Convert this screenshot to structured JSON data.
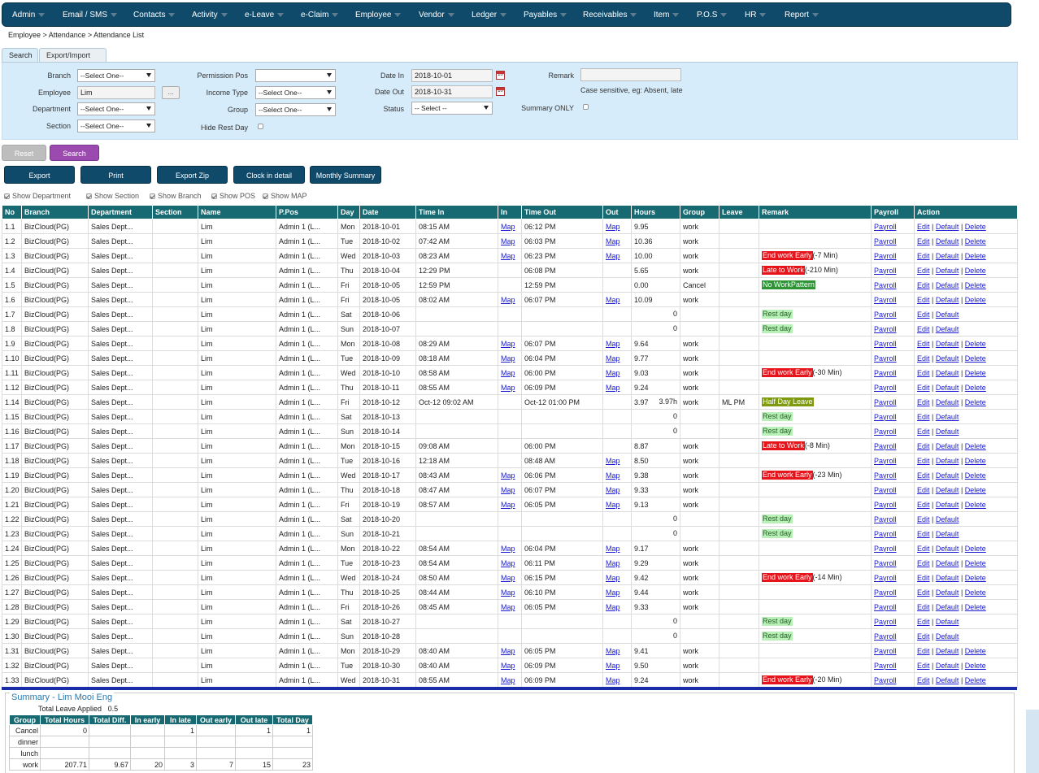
{
  "nav": [
    "Admin",
    "Email / SMS",
    "Contacts",
    "Activity",
    "e-Leave",
    "e-Claim",
    "Employee",
    "Vendor",
    "Ledger",
    "Payables",
    "Receivables",
    "Item",
    "P.O.S",
    "HR",
    "Report"
  ],
  "breadcrumb": "Employee > Attendance > Attendance List",
  "tabs": {
    "search": "Search",
    "export": "Export/Import"
  },
  "filter": {
    "branch_label": "Branch",
    "branch_value": "--Select One--",
    "employee_label": "Employee",
    "employee_value": "Lim",
    "employee_btn": "...",
    "department_label": "Department",
    "department_value": "--Select One--",
    "section_label": "Section",
    "section_value": "--Select One--",
    "perm_pos_label": "Permission Pos",
    "perm_pos_value": "",
    "income_type_label": "Income Type",
    "income_type_value": "--Select One--",
    "group_label": "Group",
    "group_value": "--Select One--",
    "hide_rest_label": "Hide Rest Day",
    "date_in_label": "Date In",
    "date_in_value": "2018-10-01",
    "date_out_label": "Date Out",
    "date_out_value": "2018-10-31",
    "status_label": "Status",
    "status_value": "-- Select --",
    "remark_label": "Remark",
    "remark_value": "",
    "remark_hint": "Case sensitive, eg: Absent, late",
    "summary_only_label": "Summary ONLY",
    "cal_icon_text": "10"
  },
  "buttons": {
    "reset": "Reset",
    "search": "Search",
    "export": "Export",
    "print": "Print",
    "export_zip": "Export Zip",
    "clock_detail": "Clock in detail",
    "monthly_summary": "Monthly Summary"
  },
  "show_options": [
    "Show Department",
    "Show Section",
    "Show Branch",
    "Show POS",
    "Show MAP"
  ],
  "table": {
    "headers": [
      "No",
      "Branch",
      "Department",
      "Section",
      "Name",
      "P.Pos",
      "Day",
      "Date",
      "Time In",
      "In",
      "Time Out",
      "Out",
      "Hours",
      "Group",
      "Leave",
      "Remark",
      "Payroll",
      "Action"
    ],
    "link_map": "Map",
    "link_payroll": "Payroll",
    "link_edit": "Edit",
    "link_default": "Default",
    "link_delete": "Delete",
    "sep": "|",
    "rows": [
      {
        "no": "1.1",
        "branch": "BizCloud(PG)",
        "dept": "Sales Dept...",
        "section": "",
        "name": "Lim",
        "ppos": "Admin 1 (L...",
        "day": "Mon",
        "date": "2018-10-01",
        "tin": "08:15 AM",
        "in_map": true,
        "tout": "06:12 PM",
        "out_map": true,
        "hours": "9.95",
        "group": "work",
        "leave": "",
        "remark": "",
        "remark_suffix": "",
        "tag": "",
        "delete": true
      },
      {
        "no": "1.2",
        "branch": "BizCloud(PG)",
        "dept": "Sales Dept...",
        "section": "",
        "name": "Lim",
        "ppos": "Admin 1 (L...",
        "day": "Tue",
        "date": "2018-10-02",
        "tin": "07:42 AM",
        "in_map": true,
        "tout": "06:03 PM",
        "out_map": true,
        "hours": "10.36",
        "group": "work",
        "leave": "",
        "remark": "",
        "remark_suffix": "",
        "tag": "",
        "delete": true
      },
      {
        "no": "1.3",
        "branch": "BizCloud(PG)",
        "dept": "Sales Dept...",
        "section": "",
        "name": "Lim",
        "ppos": "Admin 1 (L...",
        "day": "Wed",
        "date": "2018-10-03",
        "tin": "08:23 AM",
        "in_map": true,
        "tout": "06:23 PM",
        "out_map": true,
        "hours": "10.00",
        "group": "work",
        "leave": "",
        "remark": "End work Early",
        "remark_suffix": "(-7 Min)",
        "tag": "red",
        "delete": true
      },
      {
        "no": "1.4",
        "branch": "BizCloud(PG)",
        "dept": "Sales Dept...",
        "section": "",
        "name": "Lim",
        "ppos": "Admin 1 (L...",
        "day": "Thu",
        "date": "2018-10-04",
        "tin": "12:29 PM",
        "in_map": false,
        "tout": "06:08 PM",
        "out_map": false,
        "hours": "5.65",
        "group": "work",
        "leave": "",
        "remark": "Late to Work",
        "remark_suffix": "(-210 Min)",
        "tag": "red",
        "delete": true
      },
      {
        "no": "1.5",
        "branch": "BizCloud(PG)",
        "dept": "Sales Dept...",
        "section": "",
        "name": "Lim",
        "ppos": "Admin 1 (L...",
        "day": "Fri",
        "date": "2018-10-05",
        "tin": "12:59 PM",
        "in_map": false,
        "tout": "12:59 PM",
        "out_map": false,
        "hours": "0.00",
        "group": "Cancel",
        "leave": "",
        "remark": "No WorkPattern",
        "remark_suffix": "",
        "tag": "green",
        "delete": true
      },
      {
        "no": "1.6",
        "branch": "BizCloud(PG)",
        "dept": "Sales Dept...",
        "section": "",
        "name": "Lim",
        "ppos": "Admin 1 (L...",
        "day": "Fri",
        "date": "2018-10-05",
        "tin": "08:02 AM",
        "in_map": true,
        "tout": "06:07 PM",
        "out_map": true,
        "hours": "10.09",
        "group": "work",
        "leave": "",
        "remark": "",
        "remark_suffix": "",
        "tag": "",
        "delete": true
      },
      {
        "no": "1.7",
        "branch": "BizCloud(PG)",
        "dept": "Sales Dept...",
        "section": "",
        "name": "Lim",
        "ppos": "Admin 1 (L...",
        "day": "Sat",
        "date": "2018-10-06",
        "tin": "",
        "in_map": false,
        "tout": "",
        "out_map": false,
        "hours": "",
        "hours_right": "0",
        "group": "",
        "leave": "",
        "remark": "Rest day",
        "remark_suffix": "",
        "tag": "lgreen",
        "delete": false
      },
      {
        "no": "1.8",
        "branch": "BizCloud(PG)",
        "dept": "Sales Dept...",
        "section": "",
        "name": "Lim",
        "ppos": "Admin 1 (L...",
        "day": "Sun",
        "date": "2018-10-07",
        "tin": "",
        "in_map": false,
        "tout": "",
        "out_map": false,
        "hours": "",
        "hours_right": "0",
        "group": "",
        "leave": "",
        "remark": "Rest day",
        "remark_suffix": "",
        "tag": "lgreen",
        "delete": false
      },
      {
        "no": "1.9",
        "branch": "BizCloud(PG)",
        "dept": "Sales Dept...",
        "section": "",
        "name": "Lim",
        "ppos": "Admin 1 (L...",
        "day": "Mon",
        "date": "2018-10-08",
        "tin": "08:29 AM",
        "in_map": true,
        "tout": "06:07 PM",
        "out_map": true,
        "hours": "9.64",
        "group": "work",
        "leave": "",
        "remark": "",
        "remark_suffix": "",
        "tag": "",
        "delete": true
      },
      {
        "no": "1.10",
        "branch": "BizCloud(PG)",
        "dept": "Sales Dept...",
        "section": "",
        "name": "Lim",
        "ppos": "Admin 1 (L...",
        "day": "Tue",
        "date": "2018-10-09",
        "tin": "08:18 AM",
        "in_map": true,
        "tout": "06:04 PM",
        "out_map": true,
        "hours": "9.77",
        "group": "work",
        "leave": "",
        "remark": "",
        "remark_suffix": "",
        "tag": "",
        "delete": true
      },
      {
        "no": "1.11",
        "branch": "BizCloud(PG)",
        "dept": "Sales Dept...",
        "section": "",
        "name": "Lim",
        "ppos": "Admin 1 (L...",
        "day": "Wed",
        "date": "2018-10-10",
        "tin": "08:58 AM",
        "in_map": true,
        "tout": "06:00 PM",
        "out_map": true,
        "hours": "9.03",
        "group": "work",
        "leave": "",
        "remark": "End work Early",
        "remark_suffix": "(-30 Min)",
        "tag": "red",
        "delete": true
      },
      {
        "no": "1.12",
        "branch": "BizCloud(PG)",
        "dept": "Sales Dept...",
        "section": "",
        "name": "Lim",
        "ppos": "Admin 1 (L...",
        "day": "Thu",
        "date": "2018-10-11",
        "tin": "08:55 AM",
        "in_map": true,
        "tout": "06:09 PM",
        "out_map": true,
        "hours": "9.24",
        "group": "work",
        "leave": "",
        "remark": "",
        "remark_suffix": "",
        "tag": "",
        "delete": true
      },
      {
        "no": "1.14",
        "branch": "BizCloud(PG)",
        "dept": "Sales Dept...",
        "section": "",
        "name": "Lim",
        "ppos": "Admin 1 (L...",
        "day": "Fri",
        "date": "2018-10-12",
        "tin": "Oct-12 09:02 AM",
        "in_map": false,
        "tout": "Oct-12 01:00 PM",
        "out_map": false,
        "hours": "3.97",
        "hours_right": "3.97h",
        "group": "work",
        "leave": "ML PM",
        "remark": "Half Day Leave",
        "remark_suffix": "",
        "tag": "olive",
        "delete": true
      },
      {
        "no": "1.15",
        "branch": "BizCloud(PG)",
        "dept": "Sales Dept...",
        "section": "",
        "name": "Lim",
        "ppos": "Admin 1 (L...",
        "day": "Sat",
        "date": "2018-10-13",
        "tin": "",
        "in_map": false,
        "tout": "",
        "out_map": false,
        "hours": "",
        "hours_right": "0",
        "group": "",
        "leave": "",
        "remark": "Rest day",
        "remark_suffix": "",
        "tag": "lgreen",
        "delete": false
      },
      {
        "no": "1.16",
        "branch": "BizCloud(PG)",
        "dept": "Sales Dept...",
        "section": "",
        "name": "Lim",
        "ppos": "Admin 1 (L...",
        "day": "Sun",
        "date": "2018-10-14",
        "tin": "",
        "in_map": false,
        "tout": "",
        "out_map": false,
        "hours": "",
        "hours_right": "0",
        "group": "",
        "leave": "",
        "remark": "Rest day",
        "remark_suffix": "",
        "tag": "lgreen",
        "delete": false
      },
      {
        "no": "1.17",
        "branch": "BizCloud(PG)",
        "dept": "Sales Dept...",
        "section": "",
        "name": "Lim",
        "ppos": "Admin 1 (L...",
        "day": "Mon",
        "date": "2018-10-15",
        "tin": "09:08 AM",
        "in_map": false,
        "tout": "06:00 PM",
        "out_map": false,
        "hours": "8.87",
        "group": "work",
        "leave": "",
        "remark": "Late to Work",
        "remark_suffix": "(-8 Min)",
        "tag": "red",
        "delete": true
      },
      {
        "no": "1.18",
        "branch": "BizCloud(PG)",
        "dept": "Sales Dept...",
        "section": "",
        "name": "Lim",
        "ppos": "Admin 1 (L...",
        "day": "Tue",
        "date": "2018-10-16",
        "tin": "12:18 AM",
        "in_map": false,
        "tout": "08:48 AM",
        "out_map": true,
        "hours": "8.50",
        "group": "work",
        "leave": "",
        "remark": "",
        "remark_suffix": "",
        "tag": "",
        "delete": true
      },
      {
        "no": "1.19",
        "branch": "BizCloud(PG)",
        "dept": "Sales Dept...",
        "section": "",
        "name": "Lim",
        "ppos": "Admin 1 (L...",
        "day": "Wed",
        "date": "2018-10-17",
        "tin": "08:43 AM",
        "in_map": true,
        "tout": "06:06 PM",
        "out_map": true,
        "hours": "9.38",
        "group": "work",
        "leave": "",
        "remark": "End work Early",
        "remark_suffix": "(-23 Min)",
        "tag": "red",
        "delete": true
      },
      {
        "no": "1.20",
        "branch": "BizCloud(PG)",
        "dept": "Sales Dept...",
        "section": "",
        "name": "Lim",
        "ppos": "Admin 1 (L...",
        "day": "Thu",
        "date": "2018-10-18",
        "tin": "08:47 AM",
        "in_map": true,
        "tout": "06:07 PM",
        "out_map": true,
        "hours": "9.33",
        "group": "work",
        "leave": "",
        "remark": "",
        "remark_suffix": "",
        "tag": "",
        "delete": true
      },
      {
        "no": "1.21",
        "branch": "BizCloud(PG)",
        "dept": "Sales Dept...",
        "section": "",
        "name": "Lim",
        "ppos": "Admin 1 (L...",
        "day": "Fri",
        "date": "2018-10-19",
        "tin": "08:57 AM",
        "in_map": true,
        "tout": "06:05 PM",
        "out_map": true,
        "hours": "9.13",
        "group": "work",
        "leave": "",
        "remark": "",
        "remark_suffix": "",
        "tag": "",
        "delete": true
      },
      {
        "no": "1.22",
        "branch": "BizCloud(PG)",
        "dept": "Sales Dept...",
        "section": "",
        "name": "Lim",
        "ppos": "Admin 1 (L...",
        "day": "Sat",
        "date": "2018-10-20",
        "tin": "",
        "in_map": false,
        "tout": "",
        "out_map": false,
        "hours": "",
        "hours_right": "0",
        "group": "",
        "leave": "",
        "remark": "Rest day",
        "remark_suffix": "",
        "tag": "lgreen",
        "delete": false
      },
      {
        "no": "1.23",
        "branch": "BizCloud(PG)",
        "dept": "Sales Dept...",
        "section": "",
        "name": "Lim",
        "ppos": "Admin 1 (L...",
        "day": "Sun",
        "date": "2018-10-21",
        "tin": "",
        "in_map": false,
        "tout": "",
        "out_map": false,
        "hours": "",
        "hours_right": "0",
        "group": "",
        "leave": "",
        "remark": "Rest day",
        "remark_suffix": "",
        "tag": "lgreen",
        "delete": false
      },
      {
        "no": "1.24",
        "branch": "BizCloud(PG)",
        "dept": "Sales Dept...",
        "section": "",
        "name": "Lim",
        "ppos": "Admin 1 (L...",
        "day": "Mon",
        "date": "2018-10-22",
        "tin": "08:54 AM",
        "in_map": true,
        "tout": "06:04 PM",
        "out_map": true,
        "hours": "9.17",
        "group": "work",
        "leave": "",
        "remark": "",
        "remark_suffix": "",
        "tag": "",
        "delete": true
      },
      {
        "no": "1.25",
        "branch": "BizCloud(PG)",
        "dept": "Sales Dept...",
        "section": "",
        "name": "Lim",
        "ppos": "Admin 1 (L...",
        "day": "Tue",
        "date": "2018-10-23",
        "tin": "08:54 AM",
        "in_map": true,
        "tout": "06:11 PM",
        "out_map": true,
        "hours": "9.29",
        "group": "work",
        "leave": "",
        "remark": "",
        "remark_suffix": "",
        "tag": "",
        "delete": true
      },
      {
        "no": "1.26",
        "branch": "BizCloud(PG)",
        "dept": "Sales Dept...",
        "section": "",
        "name": "Lim",
        "ppos": "Admin 1 (L...",
        "day": "Wed",
        "date": "2018-10-24",
        "tin": "08:50 AM",
        "in_map": true,
        "tout": "06:15 PM",
        "out_map": true,
        "hours": "9.42",
        "group": "work",
        "leave": "",
        "remark": "End work Early",
        "remark_suffix": "(-14 Min)",
        "tag": "red",
        "delete": true
      },
      {
        "no": "1.27",
        "branch": "BizCloud(PG)",
        "dept": "Sales Dept...",
        "section": "",
        "name": "Lim",
        "ppos": "Admin 1 (L...",
        "day": "Thu",
        "date": "2018-10-25",
        "tin": "08:44 AM",
        "in_map": true,
        "tout": "06:10 PM",
        "out_map": true,
        "hours": "9.44",
        "group": "work",
        "leave": "",
        "remark": "",
        "remark_suffix": "",
        "tag": "",
        "delete": true
      },
      {
        "no": "1.28",
        "branch": "BizCloud(PG)",
        "dept": "Sales Dept...",
        "section": "",
        "name": "Lim",
        "ppos": "Admin 1 (L...",
        "day": "Fri",
        "date": "2018-10-26",
        "tin": "08:45 AM",
        "in_map": true,
        "tout": "06:05 PM",
        "out_map": true,
        "hours": "9.33",
        "group": "work",
        "leave": "",
        "remark": "",
        "remark_suffix": "",
        "tag": "",
        "delete": true
      },
      {
        "no": "1.29",
        "branch": "BizCloud(PG)",
        "dept": "Sales Dept...",
        "section": "",
        "name": "Lim",
        "ppos": "Admin 1 (L...",
        "day": "Sat",
        "date": "2018-10-27",
        "tin": "",
        "in_map": false,
        "tout": "",
        "out_map": false,
        "hours": "",
        "hours_right": "0",
        "group": "",
        "leave": "",
        "remark": "Rest day",
        "remark_suffix": "",
        "tag": "lgreen",
        "delete": false
      },
      {
        "no": "1.30",
        "branch": "BizCloud(PG)",
        "dept": "Sales Dept...",
        "section": "",
        "name": "Lim",
        "ppos": "Admin 1 (L...",
        "day": "Sun",
        "date": "2018-10-28",
        "tin": "",
        "in_map": false,
        "tout": "",
        "out_map": false,
        "hours": "",
        "hours_right": "0",
        "group": "",
        "leave": "",
        "remark": "Rest day",
        "remark_suffix": "",
        "tag": "lgreen",
        "delete": false
      },
      {
        "no": "1.31",
        "branch": "BizCloud(PG)",
        "dept": "Sales Dept...",
        "section": "",
        "name": "Lim",
        "ppos": "Admin 1 (L...",
        "day": "Mon",
        "date": "2018-10-29",
        "tin": "08:40 AM",
        "in_map": true,
        "tout": "06:05 PM",
        "out_map": true,
        "hours": "9.41",
        "group": "work",
        "leave": "",
        "remark": "",
        "remark_suffix": "",
        "tag": "",
        "delete": true
      },
      {
        "no": "1.32",
        "branch": "BizCloud(PG)",
        "dept": "Sales Dept...",
        "section": "",
        "name": "Lim",
        "ppos": "Admin 1 (L...",
        "day": "Tue",
        "date": "2018-10-30",
        "tin": "08:40 AM",
        "in_map": true,
        "tout": "06:09 PM",
        "out_map": true,
        "hours": "9.50",
        "group": "work",
        "leave": "",
        "remark": "",
        "remark_suffix": "",
        "tag": "",
        "delete": true
      },
      {
        "no": "1.33",
        "branch": "BizCloud(PG)",
        "dept": "Sales Dept...",
        "section": "",
        "name": "Lim",
        "ppos": "Admin 1 (L...",
        "day": "Wed",
        "date": "2018-10-31",
        "tin": "08:55 AM",
        "in_map": true,
        "tout": "06:09 PM",
        "out_map": true,
        "hours": "9.24",
        "group": "work",
        "leave": "",
        "remark": "End work Early",
        "remark_suffix": "(-20 Min)",
        "tag": "red",
        "delete": true
      }
    ]
  },
  "summary": {
    "title": "Summary - Lim Mooi Eng",
    "leave_applied_label": "Total Leave Applied",
    "leave_applied_value": "0.5",
    "headers": [
      "Group",
      "Total Hours",
      "Total Diff.",
      "In early",
      "In late",
      "Out early",
      "Out late",
      "Total Day"
    ],
    "rows": [
      [
        "Cancel",
        "0",
        "",
        "",
        "1",
        "",
        "1",
        "1"
      ],
      [
        "dinner",
        "",
        "",
        "",
        "",
        "",
        "",
        ""
      ],
      [
        "lunch",
        "",
        "",
        "",
        "",
        "",
        "",
        ""
      ],
      [
        "work",
        "207.71",
        "9.67",
        "20",
        "3",
        "7",
        "15",
        "23"
      ]
    ]
  },
  "colors": {
    "nav_bg": "#0f4a6b",
    "table_header": "#186a72",
    "filter_bg": "#d6ecfb",
    "search_btn": "#9b4bb0",
    "tag_red": "#e8141c",
    "tag_green": "#2e9436",
    "tag_rest": "#b9f0b8",
    "tag_olive": "#7f9a10",
    "link": "#1a1ad0"
  }
}
